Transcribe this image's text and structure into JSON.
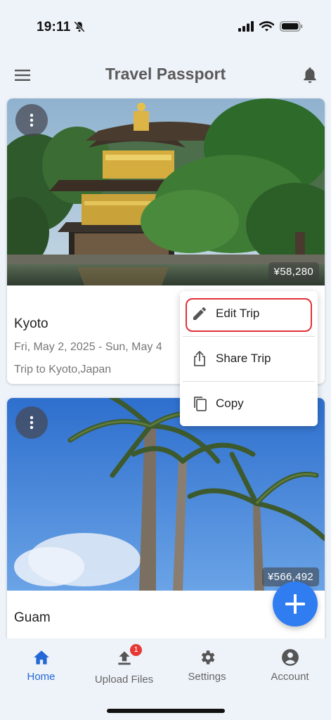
{
  "status_bar": {
    "time": "19:11"
  },
  "app_bar": {
    "title": "Travel Passport"
  },
  "trips": [
    {
      "name": "Kyoto",
      "dates": "Fri, May 2, 2025 - Sun, May 4",
      "description": "Trip to Kyoto,Japan",
      "price": "¥58,280"
    },
    {
      "name": "Guam",
      "price": "¥566,492"
    }
  ],
  "popup_menu": {
    "items": [
      {
        "label": "Edit Trip",
        "icon": "pencil-icon"
      },
      {
        "label": "Share Trip",
        "icon": "share-icon"
      },
      {
        "label": "Copy",
        "icon": "copy-icon"
      }
    ]
  },
  "bottom_nav": {
    "items": [
      {
        "label": "Home",
        "icon": "home-icon"
      },
      {
        "label": "Upload Files",
        "icon": "upload-icon",
        "badge": "1"
      },
      {
        "label": "Settings",
        "icon": "gear-icon"
      },
      {
        "label": "Account",
        "icon": "account-icon"
      }
    ]
  },
  "colors": {
    "accent": "#2f7df1",
    "nav_active": "#2468d8",
    "highlight": "#e0313a",
    "badge": "#e53935",
    "background": "#eef3fa"
  }
}
